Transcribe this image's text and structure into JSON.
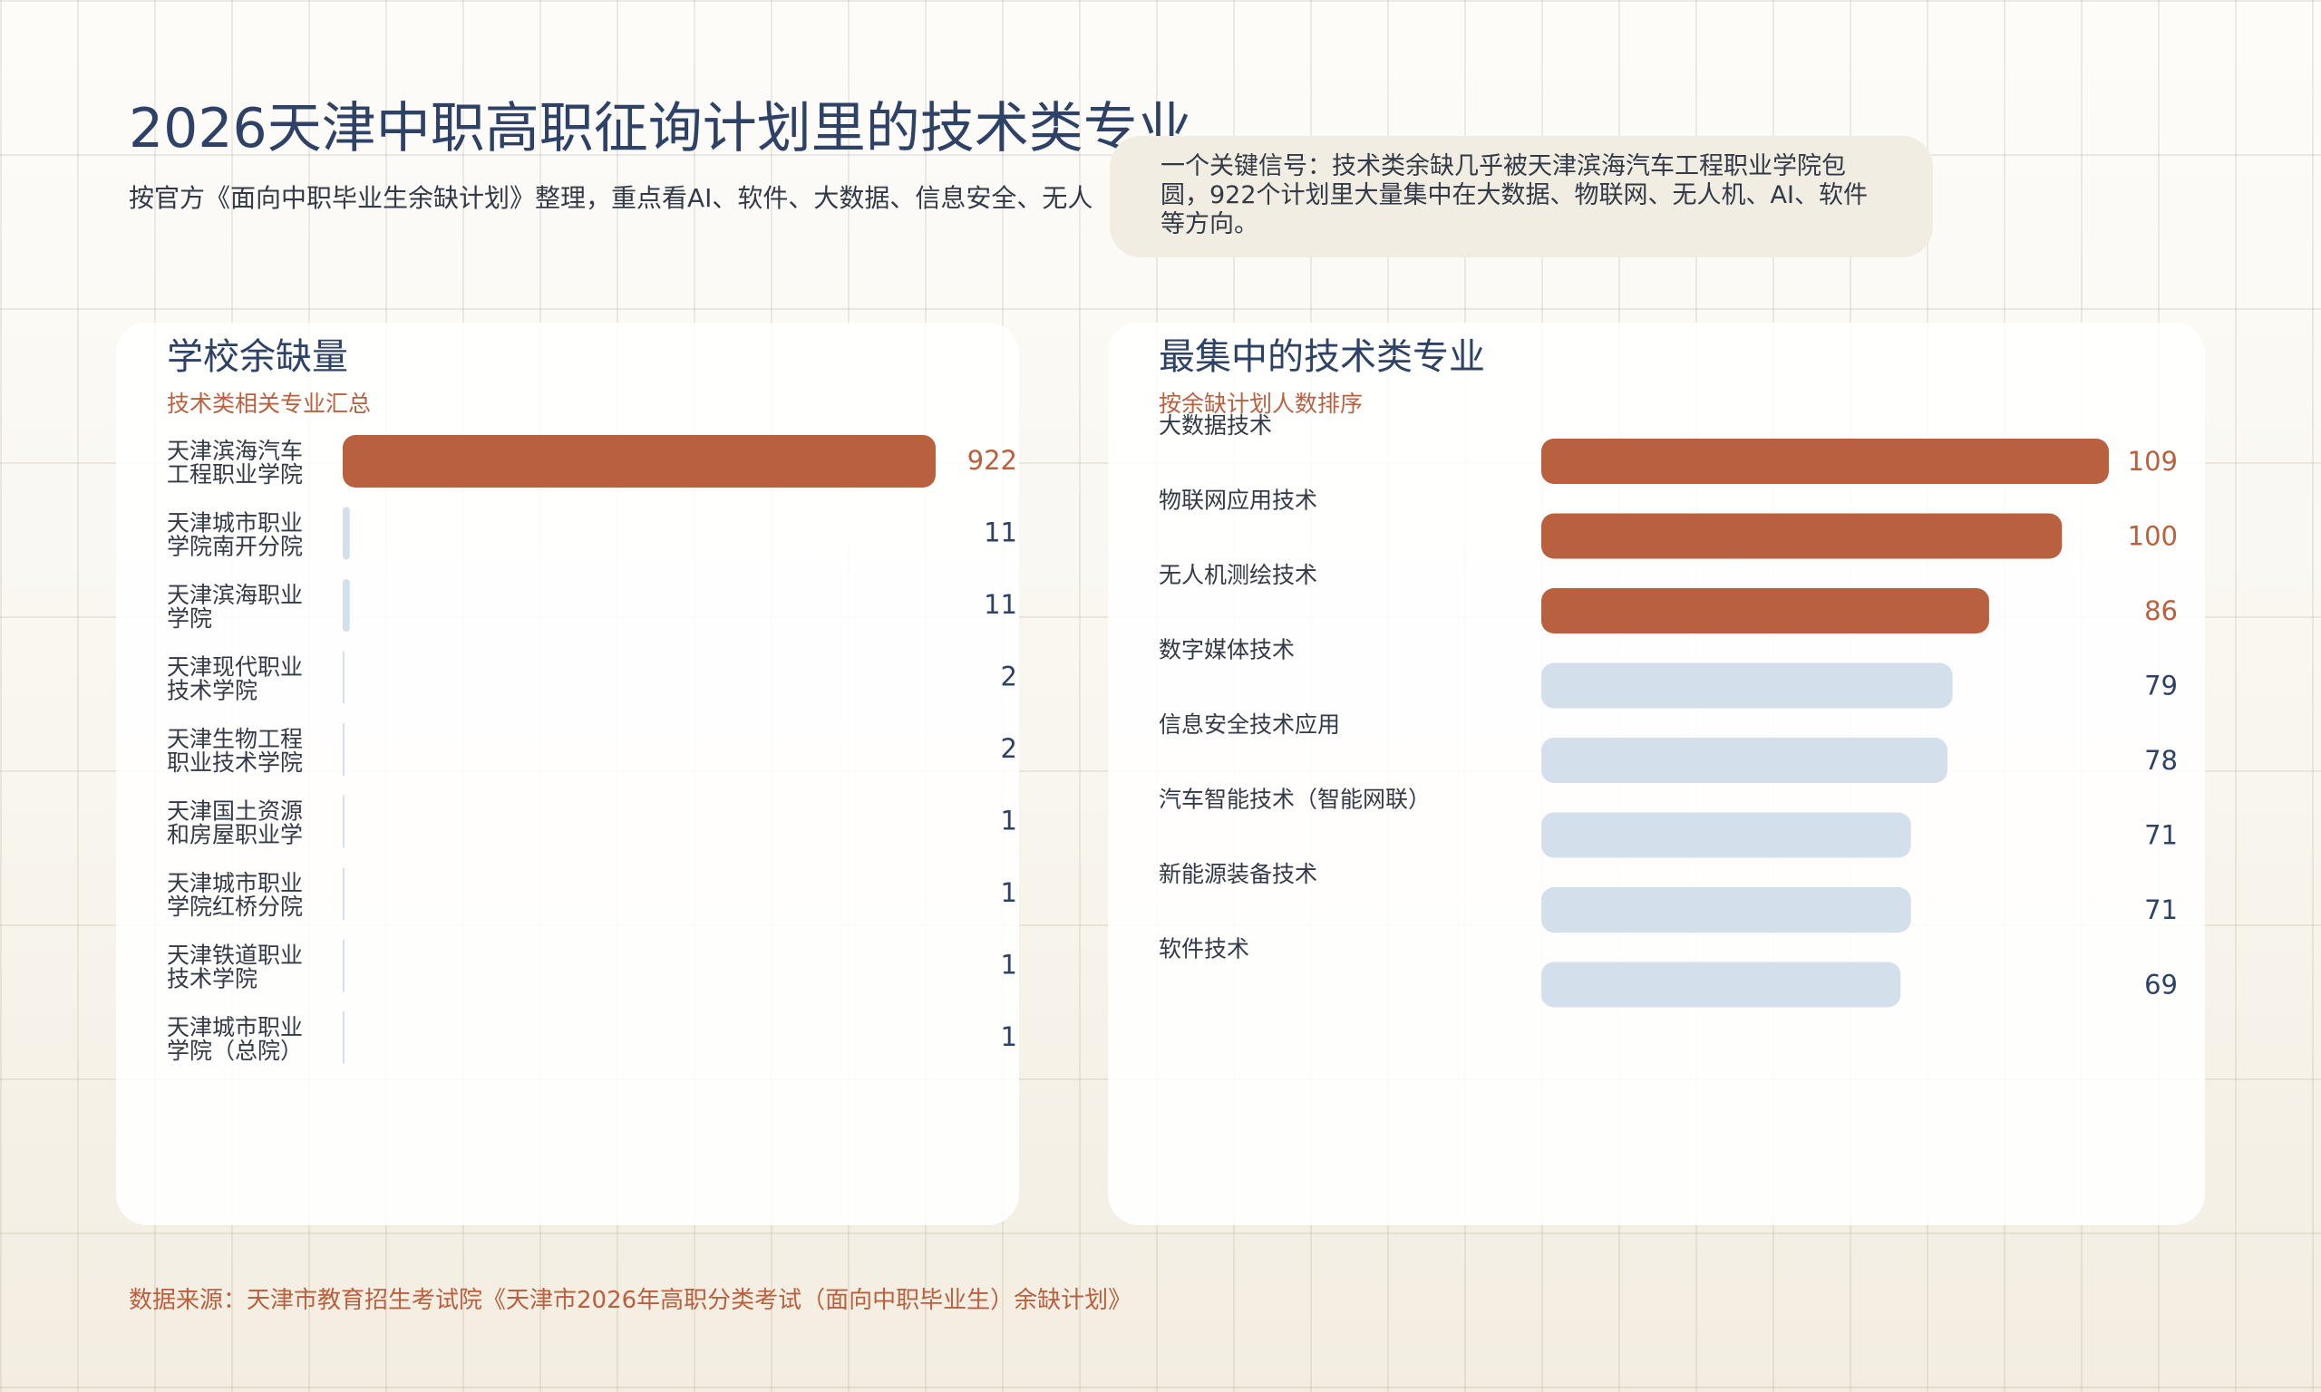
{
  "header": {
    "title": "2026天津中职高职征询计划里的技术类专业",
    "subtitle": "按官方《面向中职毕业生余缺计划》整理，重点看AI、软件、大数据、信息安全、无人"
  },
  "callout": {
    "text": "一个关键信号：技术类余缺几乎被天津滨海汽车工程职业学院包圆，922个计划里大量集中在大数据、物联网、无人机、AI、软件等方向。"
  },
  "footer": {
    "source": "数据来源：天津市教育招生考试院《天津市2026年高职分类考试（面向中职毕业生）余缺计划》"
  },
  "colors": {
    "accent": "#b9603f",
    "light_bar": "#d3dfea",
    "navy": "#2d4266"
  },
  "chart_data": [
    {
      "type": "bar",
      "orientation": "horizontal",
      "title": "学校余缺量",
      "subtitle": "技术类相关专业汇总",
      "categories": [
        [
          "天津滨海汽车",
          "工程职业学院"
        ],
        [
          "天津城市职业",
          "学院南开分院"
        ],
        [
          "天津滨海职业",
          "学院"
        ],
        [
          "天津现代职业",
          "技术学院"
        ],
        [
          "天津生物工程",
          "职业技术学院"
        ],
        [
          "天津国土资源",
          "和房屋职业学"
        ],
        [
          "天津城市职业",
          "学院红桥分院"
        ],
        [
          "天津铁道职业",
          "技术学院"
        ],
        [
          "天津城市职业",
          "学院（总院）"
        ]
      ],
      "values": [
        922,
        11,
        11,
        2,
        2,
        1,
        1,
        1,
        1
      ],
      "xlim": [
        0,
        922
      ],
      "highlight_top": 1
    },
    {
      "type": "bar",
      "orientation": "horizontal",
      "title": "最集中的技术类专业",
      "subtitle": "按余缺计划人数排序",
      "categories": [
        "大数据技术",
        "物联网应用技术",
        "无人机测绘技术",
        "数字媒体技术",
        "信息安全技术应用",
        "汽车智能技术（智能网联）",
        "新能源装备技术",
        "软件技术"
      ],
      "values": [
        109,
        100,
        86,
        79,
        78,
        71,
        71,
        69
      ],
      "xlim": [
        0,
        109
      ],
      "highlight_top": 3
    }
  ]
}
